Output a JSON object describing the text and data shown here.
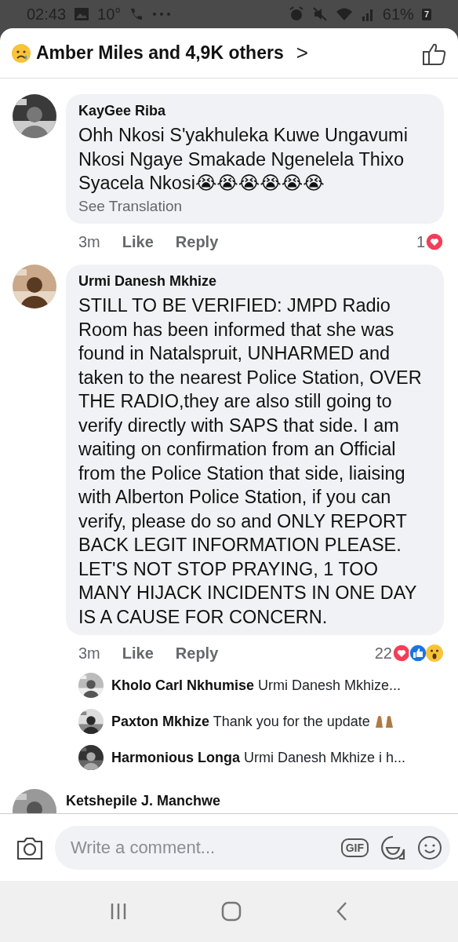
{
  "status_bar": {
    "time": "02:43",
    "temperature": "10°",
    "battery": "61%",
    "battery_badge": "7"
  },
  "header": {
    "title": "Amber Miles and 4,9K others",
    "chevron": ">"
  },
  "comments": [
    {
      "author": "KayGee Riba",
      "text": "Ohh Nkosi S'yakhuleka Kuwe Ungavumi Nkosi Ngaye Smakade Ngenelela Thixo Syacela Nkosi😭😭😭😭😭😭",
      "translation_link": "See Translation",
      "time": "3m",
      "like": "Like",
      "reply": "Reply",
      "reaction_count": "1",
      "reactions": [
        {
          "kind": "love"
        }
      ]
    },
    {
      "author": "Urmi Danesh Mkhize",
      "text": "STILL TO BE VERIFIED: JMPD Radio Room has been informed that she was found in Natalspruit, UNHARMED and taken to the nearest Police Station, OVER THE RADIO,they are also still going to verify directly with SAPS that side. I am waiting on confirmation from an  Official from the Police Station that side, liaising with Alberton Police Station, if you can verify, please do so and ONLY REPORT BACK LEGIT INFORMATION PLEASE. LET'S NOT STOP PRAYING, 1 TOO MANY HIJACK INCIDENTS IN ONE DAY IS A CAUSE FOR CONCERN.",
      "time": "3m",
      "like": "Like",
      "reply": "Reply",
      "reaction_count": "22",
      "reactions": [
        {
          "kind": "love"
        },
        {
          "kind": "like"
        },
        {
          "kind": "wow"
        }
      ],
      "replies": [
        {
          "author": "Kholo Carl Nkhumise",
          "text": "Urmi Danesh Mkhize..."
        },
        {
          "author": "Paxton Mkhize",
          "text": "Thank you for the update",
          "emojis": [
            {
              "kind": "raised-hands"
            }
          ]
        },
        {
          "author": "Harmonious Longa",
          "text": "Urmi Danesh Mkhize i h..."
        }
      ]
    },
    {
      "author": "Ketshepile J. Manchwe"
    }
  ],
  "composer": {
    "placeholder": "Write a comment...",
    "gif": "GIF"
  }
}
